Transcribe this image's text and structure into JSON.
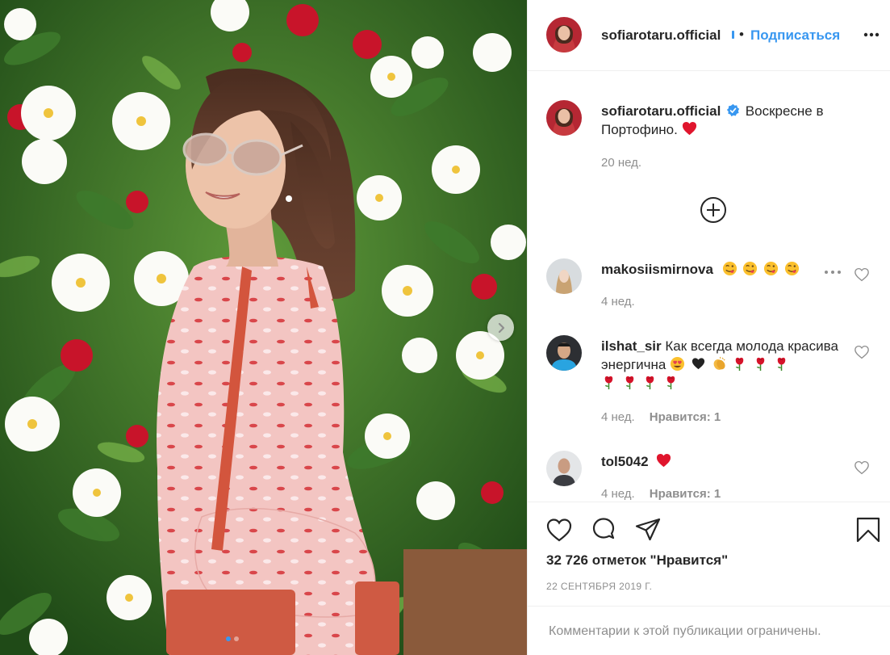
{
  "post": {
    "author": "sofiarotaru.official",
    "follow_label": "Подписаться",
    "separator": "•",
    "caption": "Воскресне в Портофино.",
    "caption_time": "20 нед.",
    "likes": "32 726 отметок \"Нравится\"",
    "date": "22 СЕНТЯБРЯ 2019 Г.",
    "comments_restricted": "Комментарии к этой публикации ограничены.",
    "carousel": {
      "slide_count": 2,
      "active_index": 0
    }
  },
  "comments": [
    {
      "user": "makosiismirnova",
      "text": "",
      "emojis": [
        "face-savoring-icon",
        "face-savoring-icon",
        "face-savoring-icon",
        "face-savoring-icon"
      ],
      "time": "4 нед.",
      "likes": ""
    },
    {
      "user": "ilshat_sir",
      "text": "Как всегда молода красива энергична",
      "emojis": [
        "heart-eyes-icon",
        "black-heart-icon",
        "clapping-hands-icon",
        "red-rose-icon",
        "red-rose-icon",
        "red-rose-icon",
        "red-rose-icon",
        "red-rose-icon",
        "red-rose-icon",
        "red-rose-icon"
      ],
      "time": "4 нед.",
      "likes": "Нравится: 1"
    },
    {
      "user": "tol5042",
      "text": "",
      "emojis": [
        "red-heart-icon"
      ],
      "time": "4 нед.",
      "likes": "Нравится: 1"
    }
  ],
  "icons": {
    "verified": "verified-badge-icon",
    "more": "more-options-icon",
    "load_more": "plus-circle-icon",
    "like": "heart-outline-icon",
    "comment": "comment-bubble-icon",
    "share": "paper-plane-icon",
    "save": "bookmark-icon",
    "next": "chevron-right-icon"
  },
  "colors": {
    "link": "#3897f0",
    "muted": "#8e8e8e",
    "text": "#262626",
    "heart": "#ed4956",
    "border": "#efefef"
  }
}
